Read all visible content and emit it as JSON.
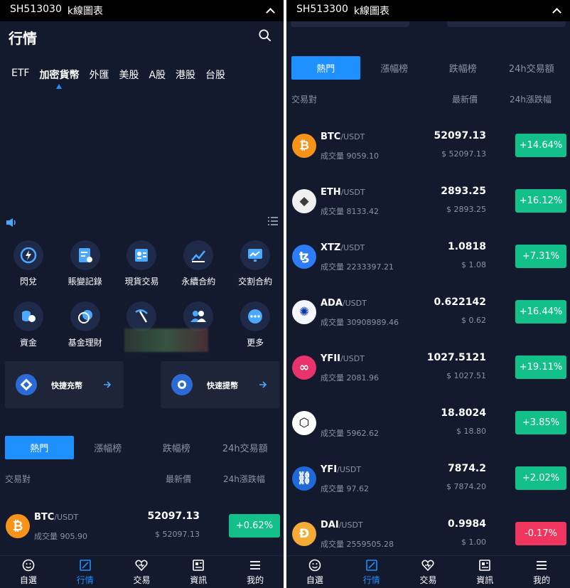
{
  "left": {
    "topbar": {
      "code": "SH513030",
      "title": "k線圖表"
    },
    "page_title": "行情",
    "market_tabs": [
      "ETF",
      "加密貨幣",
      "外匯",
      "美股",
      "A股",
      "港股",
      "台股"
    ],
    "grid_row1": [
      {
        "label": "閃兌",
        "icon": "flash-icon"
      },
      {
        "label": "賬變記錄",
        "icon": "record-icon"
      },
      {
        "label": "現貨交易",
        "icon": "spot-icon"
      },
      {
        "label": "永續合約",
        "icon": "perpetual-icon"
      },
      {
        "label": "交割合約",
        "icon": "delivery-icon"
      }
    ],
    "grid_row2": [
      {
        "label": "資金",
        "icon": "fund-icon"
      },
      {
        "label": "基金理財",
        "icon": "finance-icon"
      },
      {
        "label": "",
        "icon": "mining-icon"
      },
      {
        "label": "",
        "icon": "users-icon"
      },
      {
        "label": "更多",
        "icon": "more-icon"
      }
    ],
    "cards": [
      {
        "label": "快捷充幣"
      },
      {
        "label": "快速提幣"
      }
    ],
    "sort_tabs": [
      "熱門",
      "漲幅榜",
      "跌幅榜",
      "24h交易額"
    ],
    "headers": {
      "pair": "交易對",
      "price": "最新價",
      "change": "24h漲跌幅"
    },
    "rows": [
      {
        "base": "BTC",
        "quote": "/USDT",
        "vol": "成交量 905.90",
        "price": "52097.13",
        "fiat": "$ 52097.13",
        "chg": "+0.62%",
        "dir": "up"
      }
    ],
    "nav": [
      "自選",
      "行情",
      "交易",
      "資訊",
      "我的"
    ]
  },
  "right": {
    "topbar": {
      "code": "SH513300",
      "title": "k線圖表"
    },
    "sort_tabs": [
      "熱門",
      "漲幅榜",
      "跌幅榜",
      "24h交易額"
    ],
    "headers": {
      "pair": "交易對",
      "price": "最新價",
      "change": "24h漲跌幅"
    },
    "rows": [
      {
        "base": "BTC",
        "quote": "/USDT",
        "vol": "成交量 9059.10",
        "price": "52097.13",
        "fiat": "$ 52097.13",
        "chg": "+14.64%",
        "dir": "up",
        "color": "#f7931a",
        "icon": "btc-icon"
      },
      {
        "base": "ETH",
        "quote": "/USDT",
        "vol": "成交量 8133.42",
        "price": "2893.25",
        "fiat": "$ 2893.25",
        "chg": "+16.12%",
        "dir": "up",
        "color": "#f0f0f0",
        "icon": "eth-icon"
      },
      {
        "base": "XTZ",
        "quote": "/USDT",
        "vol": "成交量 2233397.21",
        "price": "1.0818",
        "fiat": "$ 1.08",
        "chg": "+7.31%",
        "dir": "up",
        "color": "#2c7df7",
        "icon": "xtz-icon"
      },
      {
        "base": "ADA",
        "quote": "/USDT",
        "vol": "成交量 30908989.46",
        "price": "0.622142",
        "fiat": "$ 0.62",
        "chg": "+16.44%",
        "dir": "up",
        "color": "#f4f6fb",
        "icon": "ada-icon"
      },
      {
        "base": "YFII",
        "quote": "/USDT",
        "vol": "成交量 2081.96",
        "price": "1027.5121",
        "fiat": "$ 1027.51",
        "chg": "+19.11%",
        "dir": "up",
        "color": "#e8336d",
        "icon": "yfii-icon"
      },
      {
        "base": "",
        "quote": "",
        "vol": "成交量 5962.62",
        "price": "18.8024",
        "fiat": "$ 18.80",
        "chg": "+3.85%",
        "dir": "up",
        "color": "#ffffff",
        "icon": "cube-icon"
      },
      {
        "base": "YFI",
        "quote": "/USDT",
        "vol": "成交量 97.62",
        "price": "7874.2",
        "fiat": "$ 7874.20",
        "chg": "+2.02%",
        "dir": "up",
        "color": "#1f6ad8",
        "icon": "yfi-icon"
      },
      {
        "base": "DAI",
        "quote": "/USDT",
        "vol": "成交量 2559505.28",
        "price": "0.9984",
        "fiat": "$ 1.00",
        "chg": "-0.17%",
        "dir": "down",
        "color": "#f5ac37",
        "icon": "dai-icon"
      }
    ],
    "nav": [
      "自選",
      "行情",
      "交易",
      "資訊",
      "我的"
    ]
  }
}
